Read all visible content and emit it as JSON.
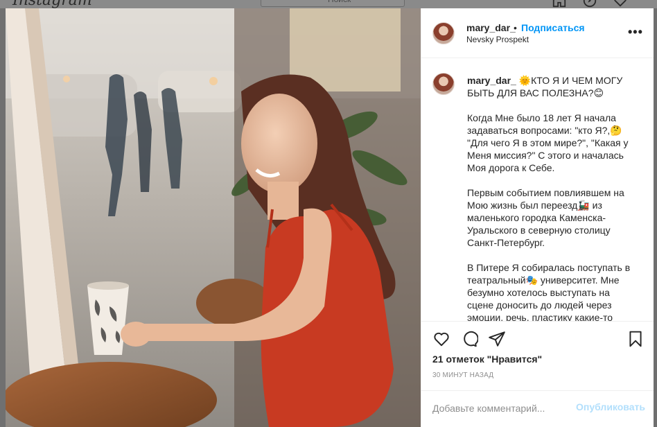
{
  "topbar": {
    "logo": "Instagram",
    "search_placeholder": "Поиск",
    "icons": [
      "home-icon",
      "explore-icon",
      "heart-icon"
    ]
  },
  "post": {
    "username": "mary_dar_",
    "separator": "•",
    "follow_label": "Подписаться",
    "location": "Nevsky Prospekt",
    "more_label": "•••",
    "caption": {
      "username": "mary_dar_",
      "line1": "🌞КТО Я И ЧЕМ МОГУ БЫТЬ ДЛЯ ВАС ПОЛЕЗНА?😊",
      "p1": "Когда Мне было 18 лет Я начала задаваться вопросами: \"кто Я?,🤔 \"Для чего Я в этом мире?\", \"Какая у Меня миссия?\" С этого и началась Моя дорога к Себе.",
      "p2": "Первым событием повлиявшем на Мою жизнь был переезд🚂 из маленького городка Каменска-Уральского в северную столицу Санкт-Петербург.",
      "p3": "В Питере Я собиралась поступать в театральный🎭 университет. Мне безумно хотелось выступать на сцене доносить до людей через эмоции, речь, пластику какие-то"
    },
    "likes_text": "21 отметок \"Нравится\"",
    "time_text": "30 МИНУТ НАЗАД",
    "comment_placeholder": "Добавьте комментарий...",
    "publish_label": "Опубликовать"
  },
  "colors": {
    "accent": "#0095f6",
    "publish_disabled": "#b2dffc",
    "muted": "#8e8e8e",
    "overlay": "#6f6f6f"
  }
}
